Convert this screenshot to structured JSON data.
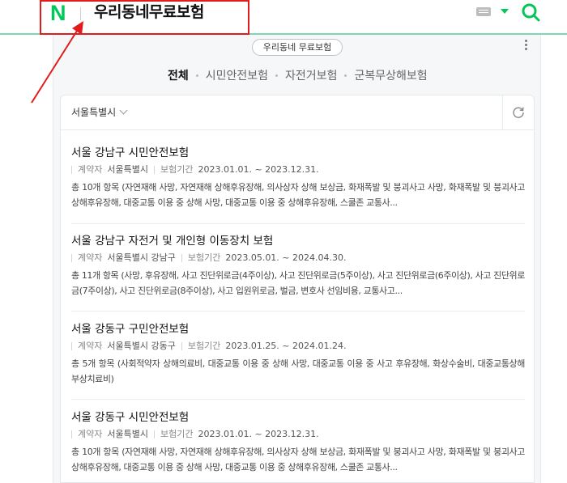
{
  "header": {
    "logo_letter": "N",
    "site_title": "우리동네무료보험"
  },
  "panel": {
    "pill_label": "우리동네 무료보험",
    "tabs": [
      {
        "label": "전체",
        "active": true
      },
      {
        "label": "시민안전보험",
        "active": false
      },
      {
        "label": "자전거보험",
        "active": false
      },
      {
        "label": "군복무상해보험",
        "active": false
      }
    ],
    "region_select": "서울특별시"
  },
  "items": [
    {
      "title": "서울 강남구 시민안전보험",
      "contractor_label": "계약자",
      "contractor": "서울특별시",
      "period_label": "보험기간",
      "period": "2023.01.01. ~ 2023.12.31.",
      "desc": "총 10개 항목 (자연재해 사망, 자연재해 상해후유장해, 의사상자 상해 보상금, 화재폭발 및 붕괴사고 사망, 화재폭발 및 붕괴사고 상해후유장해, 대중교통 이용 중 상해 사망, 대중교통 이용 중 상해후유장해, 스쿨존 교통사..."
    },
    {
      "title": "서울 강남구 자전거 및 개인형 이동장치 보험",
      "contractor_label": "계약자",
      "contractor": "서울특별시 강남구",
      "period_label": "보험기간",
      "period": "2023.05.01. ~ 2024.04.30.",
      "desc": "총 11개 항목 (사망, 후유장해, 사고 진단위로금(4주이상), 사고 진단위로금(5주이상), 사고 진단위로금(6주이상), 사고 진단위로금(7주이상), 사고 진단위로금(8주이상), 사고 입원위로금, 벌금, 변호사 선임비용, 교통사고..."
    },
    {
      "title": "서울 강동구 구민안전보험",
      "contractor_label": "계약자",
      "contractor": "서울특별시 강동구",
      "period_label": "보험기간",
      "period": "2023.01.25. ~ 2024.01.24.",
      "desc": "총 5개 항목 (사회적약자 상해의료비, 대중교통 이용 중 상해 사망, 대중교통 이용 중 사고 후유장해, 화상수술비, 대중교통상해 부상치료비)"
    },
    {
      "title": "서울 강동구 시민안전보험",
      "contractor_label": "계약자",
      "contractor": "서울특별시",
      "period_label": "보험기간",
      "period": "2023.01.01. ~ 2023.12.31.",
      "desc": "총 10개 항목 (자연재해 사망, 자연재해 상해후유장해, 의사상자 상해 보상금, 화재폭발 및 붕괴사고 사망, 화재폭발 및 붕괴사고 상해후유장해, 대중교통 이용 중 상해 사망, 대중교통 이용 중 상해후유장해, 스쿨존 교통사..."
    }
  ],
  "colors": {
    "brand": "#03c75a",
    "annotation": "#e01c1c"
  }
}
